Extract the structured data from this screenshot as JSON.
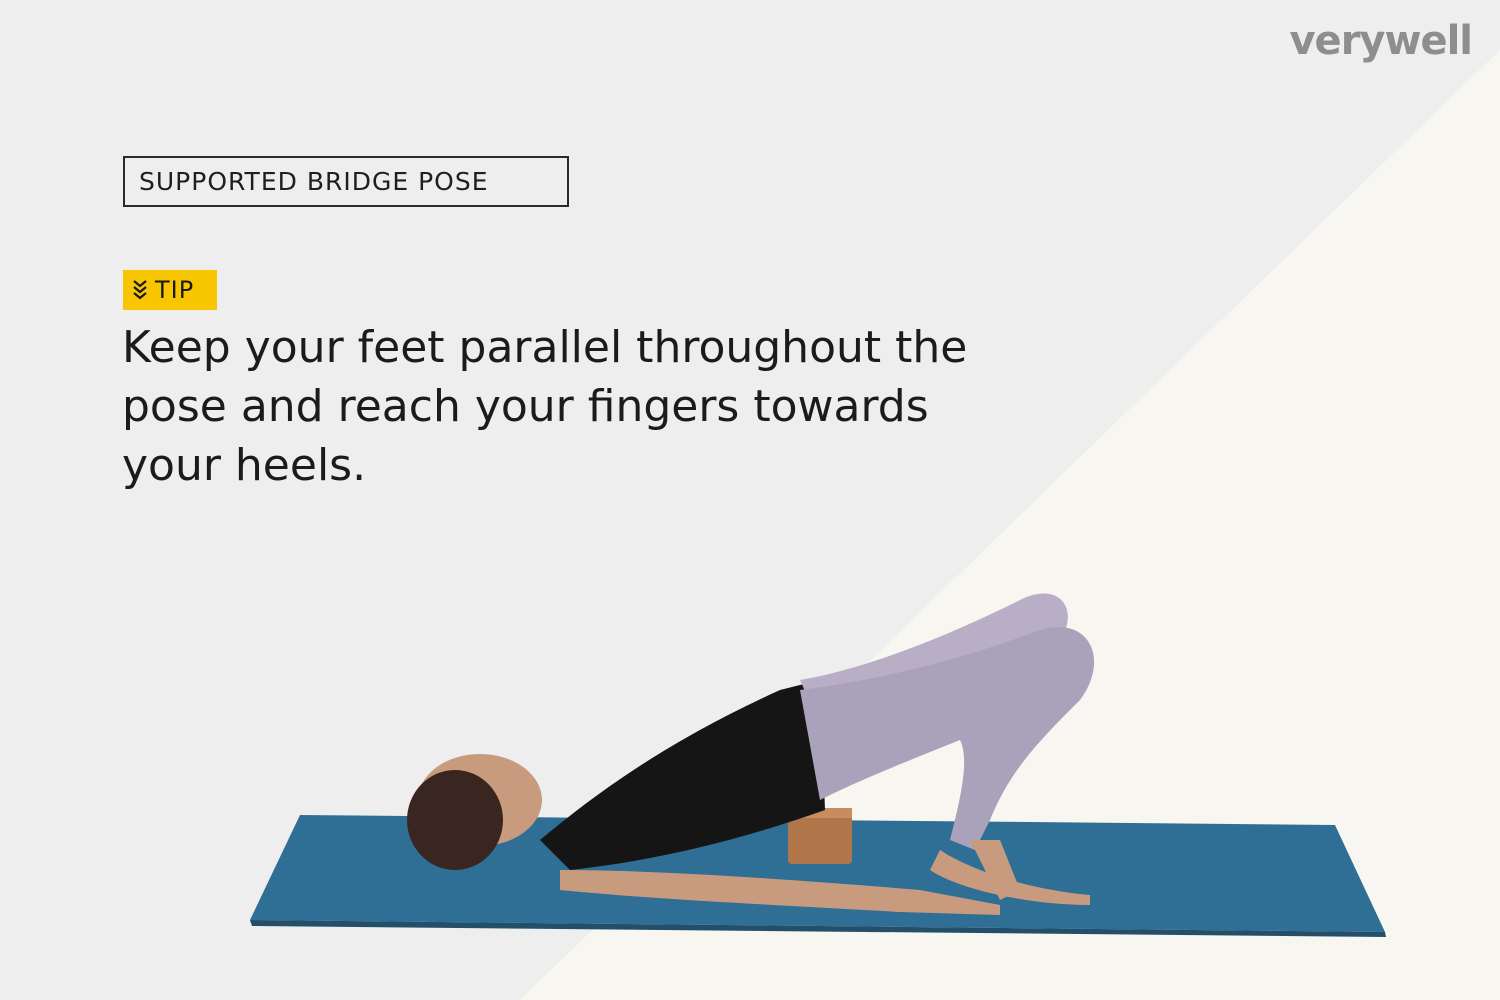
{
  "brand": {
    "name": "verywell"
  },
  "pose_label": "SUPPORTED BRIDGE POSE",
  "tip": {
    "badge": "TIP",
    "icon": "chevrons-down-icon",
    "text": "Keep your feet parallel throughout the pose and reach your fingers towards your heels."
  },
  "photo": {
    "subject": "woman-in-supported-bridge-pose-icon"
  },
  "colors": {
    "background": "#efeeee",
    "background_light": "#f8f6f1",
    "accent_yellow": "#f7c600",
    "mat_blue": "#2f6f95",
    "text": "#1b1b1b",
    "brand_gray": "#8e8e8e"
  }
}
